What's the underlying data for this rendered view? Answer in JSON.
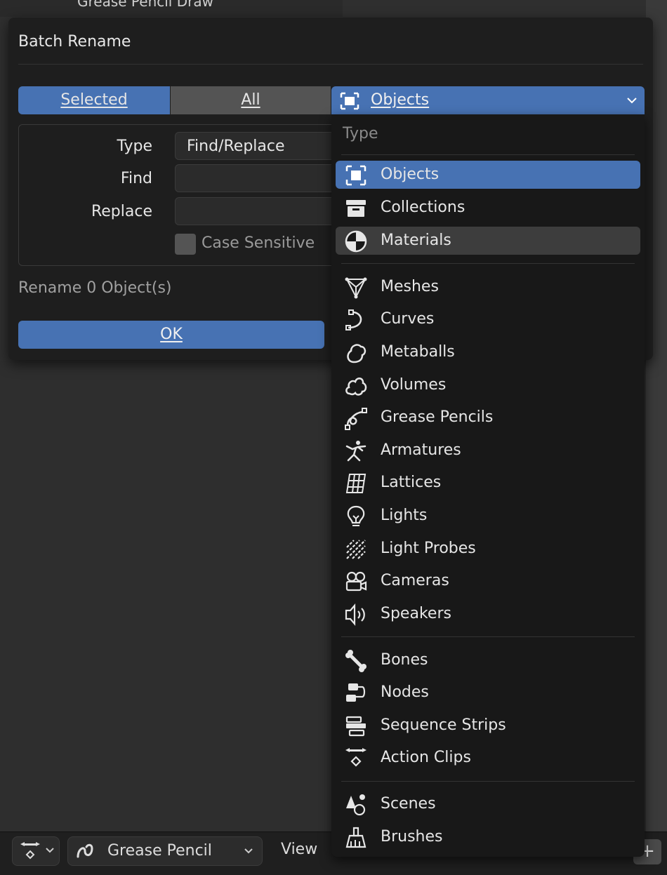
{
  "background": {
    "breadcrumb": "Grease Pencil Draw",
    "header": {
      "object_mode_label": "Grease Pencil",
      "menu_view": "View"
    }
  },
  "dialog": {
    "title": "Batch Rename",
    "scope_tabs": [
      {
        "label": "Selected",
        "active": true
      },
      {
        "label": "All",
        "active": false
      }
    ],
    "data_type": {
      "label": "Objects",
      "icon": "object-icon"
    },
    "type_label": "Type",
    "type_value": "Find/Replace",
    "find_label": "Find",
    "find_value": "",
    "replace_label": "Replace",
    "replace_value": "",
    "case_sensitive_label": "Case Sensitive",
    "case_sensitive_checked": false,
    "rename_count": "Rename 0 Object(s)",
    "ok_label": "OK"
  },
  "dropdown": {
    "header": "Type",
    "items": [
      {
        "label": "Objects",
        "icon": "object-icon",
        "state": "active"
      },
      {
        "label": "Collections",
        "icon": "collection-icon",
        "state": ""
      },
      {
        "label": "Materials",
        "icon": "material-icon",
        "state": "hover"
      },
      {
        "label": "Meshes",
        "icon": "mesh-icon",
        "state": ""
      },
      {
        "label": "Curves",
        "icon": "curve-icon",
        "state": ""
      },
      {
        "label": "Metaballs",
        "icon": "metaball-icon",
        "state": ""
      },
      {
        "label": "Volumes",
        "icon": "volume-icon",
        "state": ""
      },
      {
        "label": "Grease Pencils",
        "icon": "grease-pencil-icon",
        "state": ""
      },
      {
        "label": "Armatures",
        "icon": "armature-icon",
        "state": ""
      },
      {
        "label": "Lattices",
        "icon": "lattice-icon",
        "state": ""
      },
      {
        "label": "Lights",
        "icon": "light-icon",
        "state": ""
      },
      {
        "label": "Light Probes",
        "icon": "light-probe-icon",
        "state": ""
      },
      {
        "label": "Cameras",
        "icon": "camera-icon",
        "state": ""
      },
      {
        "label": "Speakers",
        "icon": "speaker-icon",
        "state": ""
      },
      {
        "label": "Bones",
        "icon": "bone-icon",
        "state": ""
      },
      {
        "label": "Nodes",
        "icon": "node-icon",
        "state": ""
      },
      {
        "label": "Sequence Strips",
        "icon": "sequence-strip-icon",
        "state": ""
      },
      {
        "label": "Action Clips",
        "icon": "action-clip-icon",
        "state": ""
      },
      {
        "label": "Scenes",
        "icon": "scene-icon",
        "state": ""
      },
      {
        "label": "Brushes",
        "icon": "brush-icon",
        "state": ""
      }
    ]
  },
  "colors": {
    "accent": "#4772b3",
    "dialog_bg": "#1e1e1e",
    "menu_bg": "#181818",
    "hover": "#3d3d3d"
  }
}
